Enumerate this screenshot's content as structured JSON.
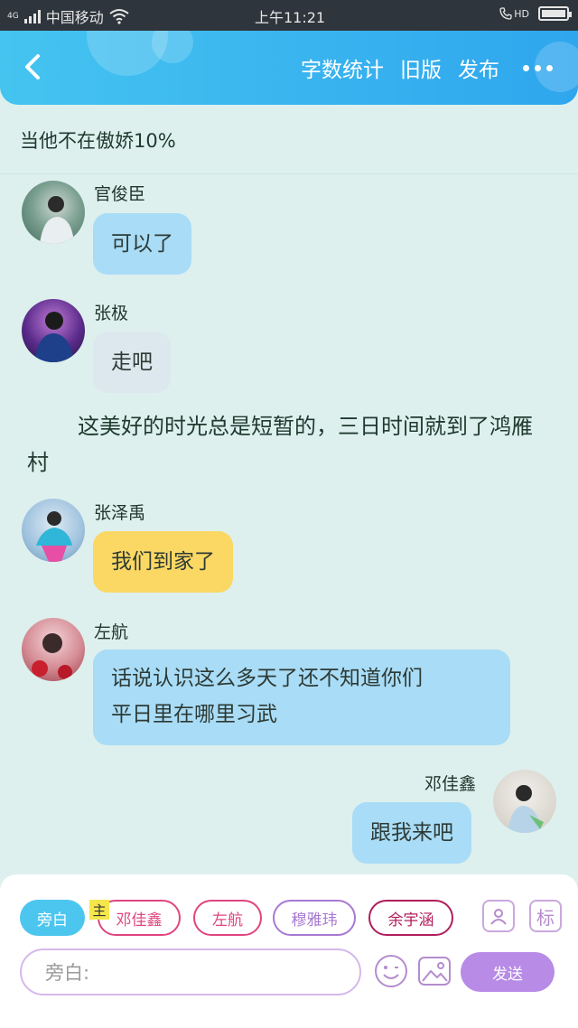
{
  "status_bar": {
    "network": "4G",
    "carrier": "中国移动",
    "time": "上午11:21",
    "hd": "HD"
  },
  "header": {
    "word_count": "字数统计",
    "old_version": "旧版",
    "publish": "发布"
  },
  "chat_title": "当他不在傲娇10%",
  "messages": [
    {
      "sender": "官俊臣",
      "text": "可以了",
      "color": "#a9dcf6"
    },
    {
      "sender": "张极",
      "text": "走吧",
      "color": "#dde8ee"
    },
    {
      "sender": "张泽禹",
      "text": "我们到家了",
      "color": "#fbd863"
    },
    {
      "sender": "左航",
      "line1": "话说认识这么多天了还不知道你们",
      "line2": "平日里在哪里习武",
      "color": "#a9dcf6"
    },
    {
      "sender": "邓佳鑫",
      "text": "跟我来吧",
      "color": "#a9dcf6"
    }
  ],
  "narration": "这美好的时光总是短暂的，三日时间就到了鸿雁村",
  "roles": {
    "narrator": "旁白",
    "main_badge": "主",
    "chips": [
      "邓佳鑫",
      "左航",
      "穆雅玮",
      "余宇涵"
    ],
    "chip_colors": [
      "#e0457f",
      "#e0457f",
      "#a879d2",
      "#b01e5b"
    ]
  },
  "tag_button": "标",
  "input": {
    "placeholder": "旁白:"
  },
  "send_label": "发送",
  "colors": {
    "accent": "#45c4f0",
    "background": "#ddf0ee",
    "send": "#b78be6"
  }
}
